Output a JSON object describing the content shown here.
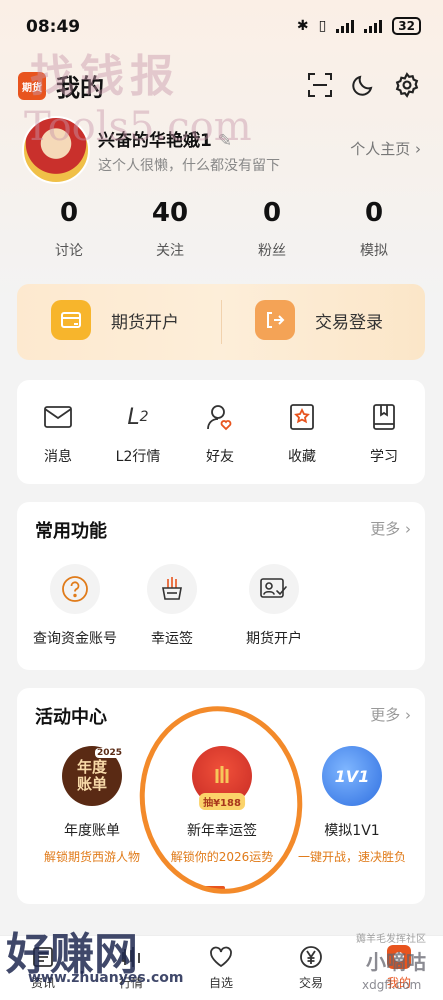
{
  "status": {
    "time": "08:49",
    "battery": "32"
  },
  "header": {
    "logo_text": "期货",
    "title": "我的"
  },
  "profile": {
    "username": "兴奋的华艳娥1",
    "bio": "这个人很懒，什么都没有留下",
    "homepage_label": "个人主页"
  },
  "stats": [
    {
      "value": "0",
      "label": "讨论"
    },
    {
      "value": "40",
      "label": "关注"
    },
    {
      "value": "0",
      "label": "粉丝"
    },
    {
      "value": "0",
      "label": "模拟"
    }
  ],
  "banner": {
    "open_account": "期货开户",
    "trade_login": "交易登录"
  },
  "quick": [
    {
      "label": "消息",
      "icon": "mail-icon"
    },
    {
      "label": "L2行情",
      "icon": "l2-icon"
    },
    {
      "label": "好友",
      "icon": "friend-icon"
    },
    {
      "label": "收藏",
      "icon": "star-icon"
    },
    {
      "label": "学习",
      "icon": "book-icon"
    }
  ],
  "common": {
    "title": "常用功能",
    "more": "更多",
    "items": [
      {
        "label": "查询资金账号",
        "icon": "question-icon"
      },
      {
        "label": "幸运签",
        "icon": "lucky-pot-icon"
      },
      {
        "label": "期货开户",
        "icon": "id-card-icon"
      }
    ]
  },
  "activity": {
    "title": "活动中心",
    "more": "更多",
    "items": [
      {
        "name": "年度账单",
        "sub": "解锁期货西游人物",
        "badge": "2025",
        "art": "年度账单"
      },
      {
        "name": "新年幸运签",
        "sub": "解锁你的2026运势",
        "badge": "抽¥188"
      },
      {
        "name": "模拟1V1",
        "sub": "一键开战，速决胜负",
        "badge": "1V1"
      }
    ]
  },
  "nav": [
    {
      "label": "资讯"
    },
    {
      "label": "行情"
    },
    {
      "label": "自选"
    },
    {
      "label": "交易"
    },
    {
      "label": "我的"
    }
  ],
  "watermarks": {
    "top_text": "找钱报",
    "top_en": "Tools5.com",
    "bottom_text": "好赚网",
    "bottom_url": "www.zhuanyes.com",
    "br_brand": "小嘀咕",
    "br_url": "xdgfl.com",
    "br_small": "薅羊毛发挥社区"
  },
  "colors": {
    "accent": "#e8541e",
    "orange_text": "#e07b1a",
    "mark": "#f38a2a"
  }
}
